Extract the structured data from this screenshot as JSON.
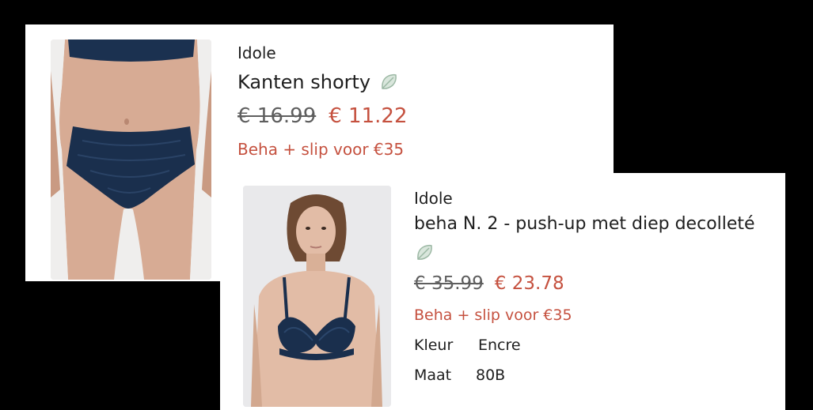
{
  "products": [
    {
      "brand": "Idole",
      "title": "Kanten shorty",
      "eco_icon": "leaf-icon",
      "price_old": "€ 16.99",
      "price_new": "€ 11.22",
      "promo": "Beha + slip voor €35"
    },
    {
      "brand": "Idole",
      "title": "beha N. 2 - push-up met diep decolleté",
      "eco_icon": "leaf-icon",
      "price_old": "€ 35.99",
      "price_new": "€ 23.78",
      "promo": "Beha + slip voor €35",
      "attributes": [
        {
          "label": "Kleur",
          "value": "Encre"
        },
        {
          "label": "Maat",
          "value": "80B"
        }
      ]
    }
  ],
  "colors": {
    "background": "#000000",
    "card": "#ffffff",
    "text": "#1e1e1e",
    "price_old": "#5e5e5e",
    "accent": "#c5513f",
    "leaf": "#9cb8a4",
    "fabric": "#1a2f4d"
  }
}
